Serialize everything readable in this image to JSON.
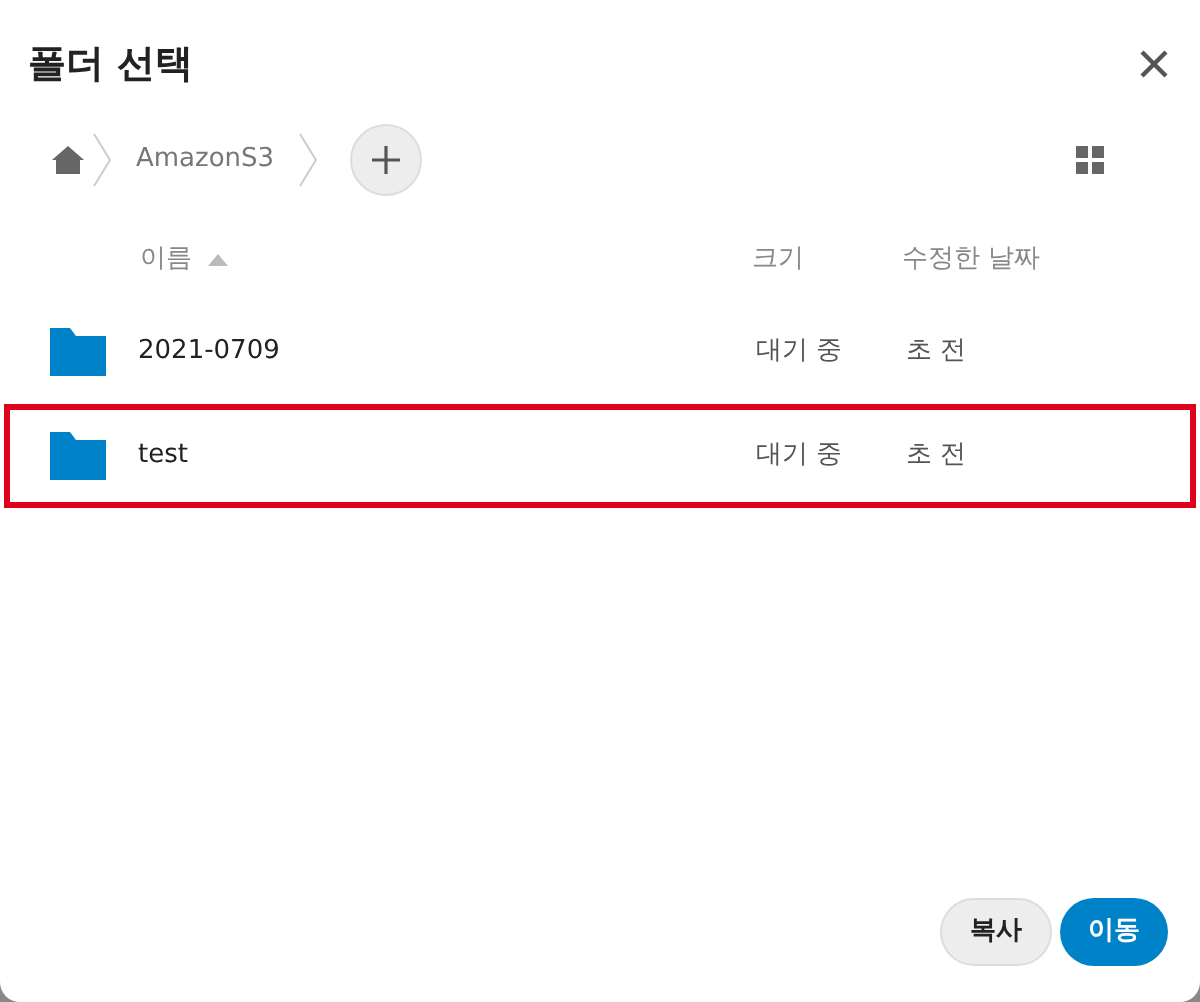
{
  "dialog": {
    "title": "폴더 선택"
  },
  "breadcrumb": [
    {
      "kind": "home"
    },
    {
      "kind": "folder",
      "label": "AmazonS3"
    }
  ],
  "columns": [
    {
      "label": "이름",
      "sorted": true
    },
    {
      "label": "크기",
      "sorted": false
    },
    {
      "label": "수정한 날짜",
      "sorted": false
    }
  ],
  "rows": [
    {
      "name": "2021-0709",
      "size": "대기 중",
      "modified": "초 전",
      "highlighted": false
    },
    {
      "name": "test",
      "size": "대기 중",
      "modified": "초 전",
      "highlighted": true
    }
  ],
  "buttons": [
    {
      "label": "복사",
      "primary": false
    },
    {
      "label": "이동",
      "primary": true
    }
  ]
}
